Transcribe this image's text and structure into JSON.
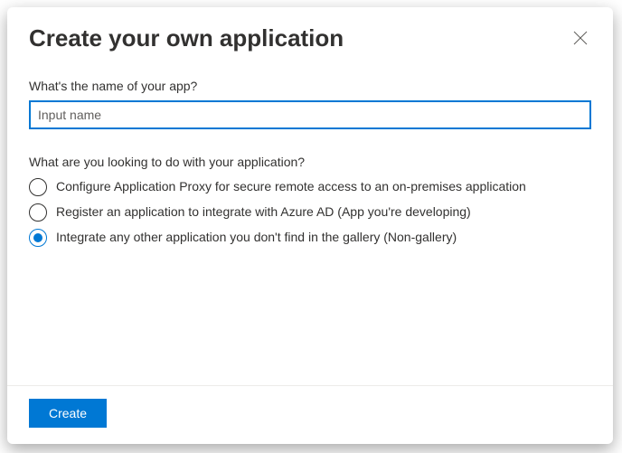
{
  "title": "Create your own application",
  "nameLabel": "What's the name of your app?",
  "namePlaceholder": "Input name",
  "nameValue": "",
  "question": "What are you looking to do with your application?",
  "options": [
    {
      "label": "Configure Application Proxy for secure remote access to an on-premises application",
      "selected": false
    },
    {
      "label": "Register an application to integrate with Azure AD (App you're developing)",
      "selected": false
    },
    {
      "label": "Integrate any other application you don't find in the gallery (Non-gallery)",
      "selected": true
    }
  ],
  "createLabel": "Create"
}
